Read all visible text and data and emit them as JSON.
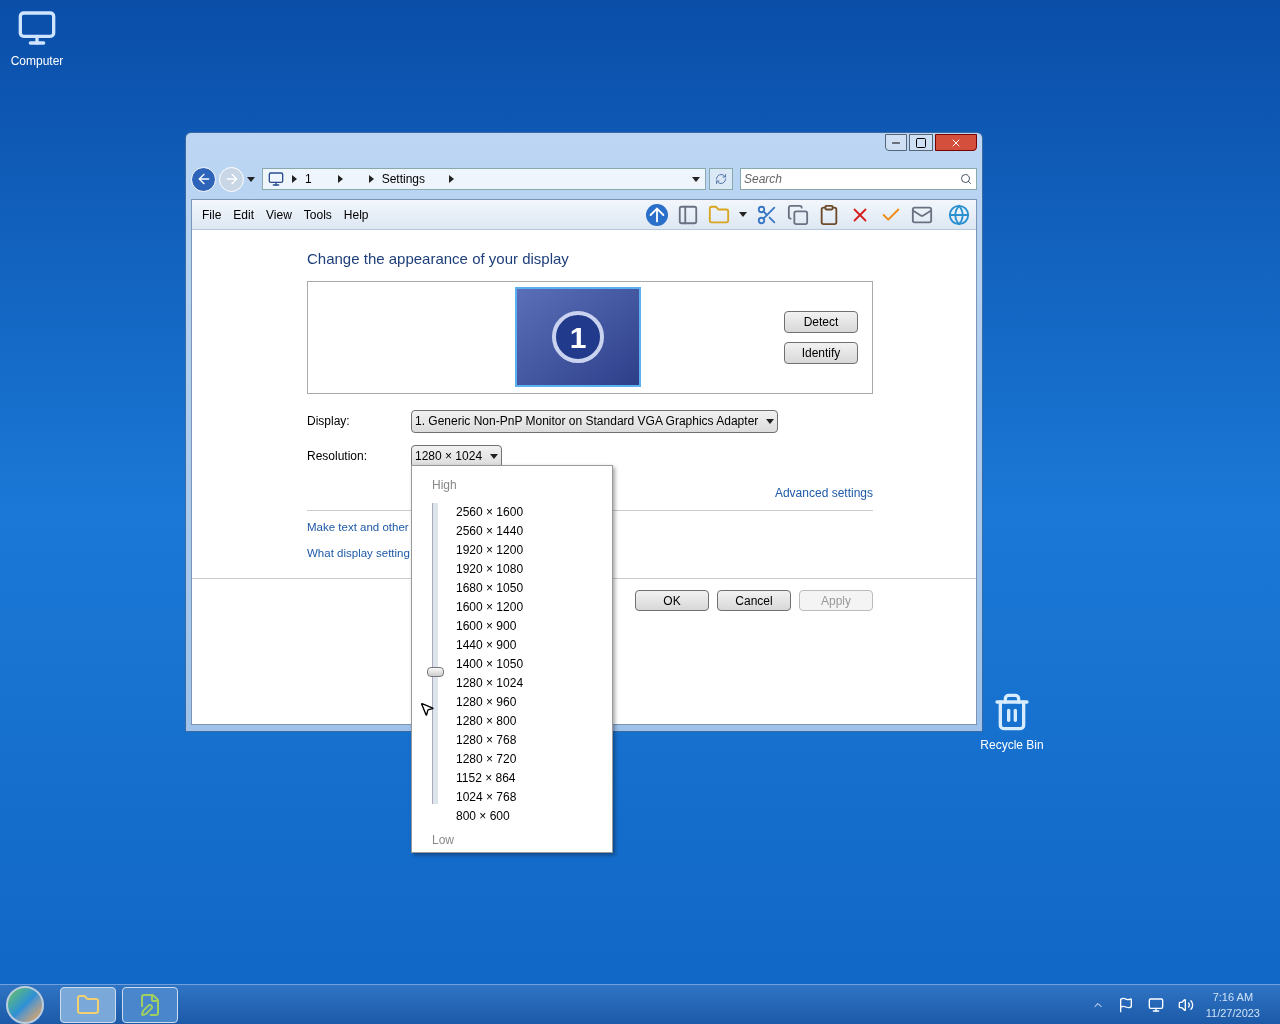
{
  "desktop_icons": [
    {
      "label": "Computer"
    },
    {
      "label": "Recycle Bin"
    }
  ],
  "window": {
    "address": {
      "segments": [
        "1",
        "Settings"
      ]
    },
    "search": {
      "placeholder": "Search"
    },
    "menu": [
      "File",
      "Edit",
      "View",
      "Tools",
      "Help"
    ],
    "heading": "Change the appearance of your display",
    "monitor_badge": "1",
    "preview_buttons": [
      "Detect",
      "Identify"
    ],
    "fields": [
      {
        "label": "Display:",
        "value": "1. Generic Non-PnP Monitor on Standard VGA Graphics Adapter"
      },
      {
        "label": "Resolution:",
        "value": "1280 × 1024"
      }
    ],
    "advanced_link": "Advanced settings",
    "links": [
      "Make text and other",
      "What display setting"
    ],
    "buttons": [
      {
        "label": "OK",
        "disabled": false
      },
      {
        "label": "Cancel",
        "disabled": false
      },
      {
        "label": "Apply",
        "disabled": true
      }
    ]
  },
  "resolution_dropdown": {
    "top_label": "High",
    "bottom_label": "Low",
    "level": 0.4375,
    "options": [
      "2560 × 1600",
      "2560 × 1440",
      "1920 × 1200",
      "1920 × 1080",
      "1680 × 1050",
      "1600 × 1200",
      "1600 × 900",
      "1440 × 900",
      "1400 × 1050",
      "1280 × 1024",
      "1280 × 960",
      "1280 × 800",
      "1280 × 768",
      "1280 × 720",
      "1152 × 864",
      "1024 × 768",
      "800 × 600"
    ]
  },
  "taskbar": {
    "time": "7:16 AM",
    "date": "11/27/2023"
  }
}
